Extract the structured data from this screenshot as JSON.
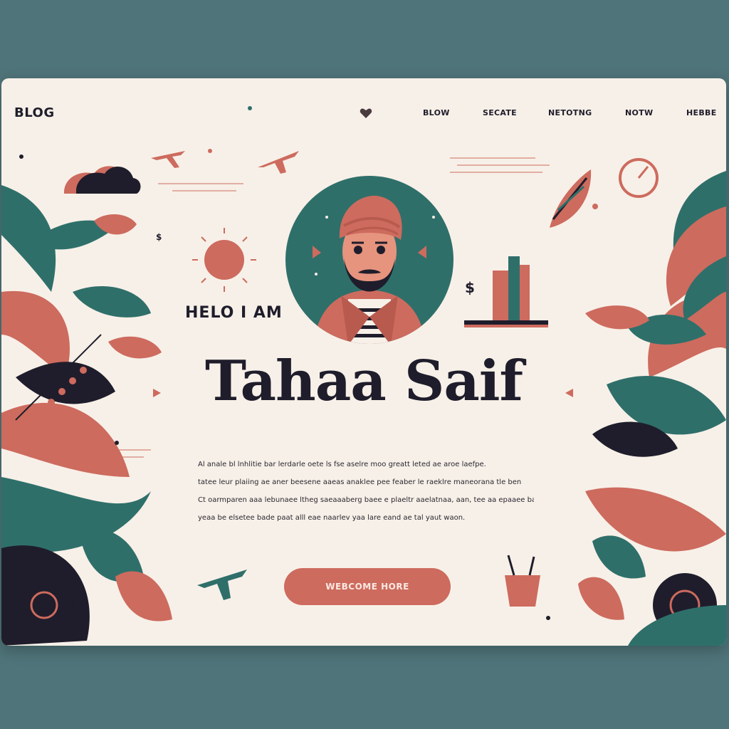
{
  "header": {
    "logo": "BLOG",
    "nav": [
      "BLOW",
      "SECATE",
      "NETOTNG",
      "NOTW",
      "HEBBE"
    ]
  },
  "hero": {
    "greeting": "HELO I AM",
    "name": "Tahaa Saif",
    "bio_lines": [
      "Al anale bl lnhlitie bar lerdarle oete ls fse aselre moo greatt leted ae aroe laefpe.",
      "tatee leur plaiing ae aner beesene aaeas anaklee pee feaber le raeklre maneorana tle ben",
      "Ct oarmparen aaa lebunaee ltheg saeaaaberg baee e plaeltr aaelatnaa, aan, tee aa epaaee ba",
      "yeaa be elsetee bade paat alll eae naarlev yaa lare eand ae tal yaut waon."
    ],
    "cta_label": "WEBCOME HORE"
  },
  "decor": {
    "chart_currency": "$",
    "small_currency": "$"
  },
  "colors": {
    "background": "#4f7479",
    "card": "#f7f0e8",
    "coral": "#cd6b5e",
    "teal": "#2f6f6a",
    "navy": "#1f1d2b"
  }
}
